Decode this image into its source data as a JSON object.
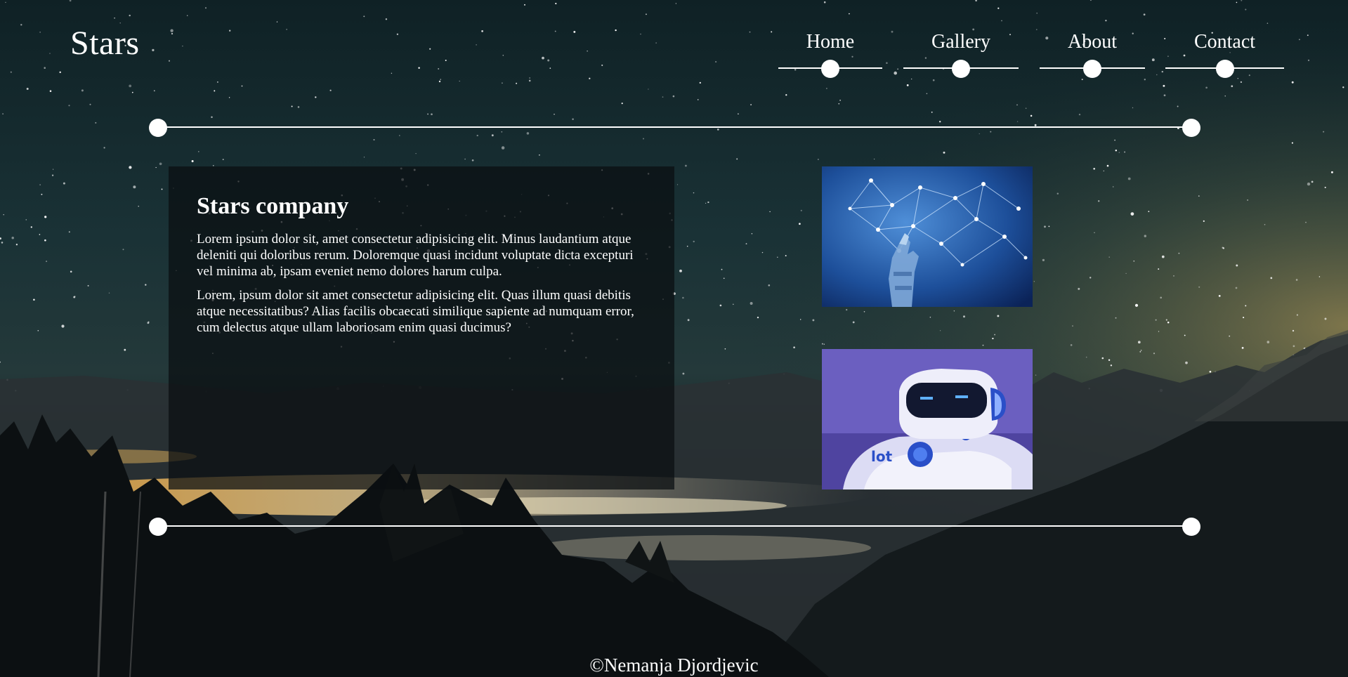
{
  "header": {
    "logo": "Stars",
    "nav": [
      {
        "label": "Home"
      },
      {
        "label": "Gallery"
      },
      {
        "label": "About"
      },
      {
        "label": "Contact"
      }
    ]
  },
  "main": {
    "title": "Stars company",
    "paragraphs": [
      "Lorem ipsum dolor sit, amet consectetur adipisicing elit. Minus laudantium atque deleniti qui doloribus rerum. Doloremque quasi incidunt voluptate dicta excepturi vel minima ab, ipsam eveniet nemo dolores harum culpa.",
      "Lorem, ipsum dolor sit amet consectetur adipisicing elit. Quas illum quasi debitis atque necessitatibus? Alias facilis obcaecati similique sapiente ad numquam error, cum delectus atque ullam laboriosam enim quasi ducimus?"
    ],
    "images": [
      {
        "icon": "network-hand-image"
      },
      {
        "icon": "robot-image"
      }
    ]
  },
  "footer": {
    "text": "©Nemanja Djordjevic"
  },
  "colors": {
    "text": "#ffffff",
    "sky": "#15282c",
    "panel": "#0a0e10"
  }
}
